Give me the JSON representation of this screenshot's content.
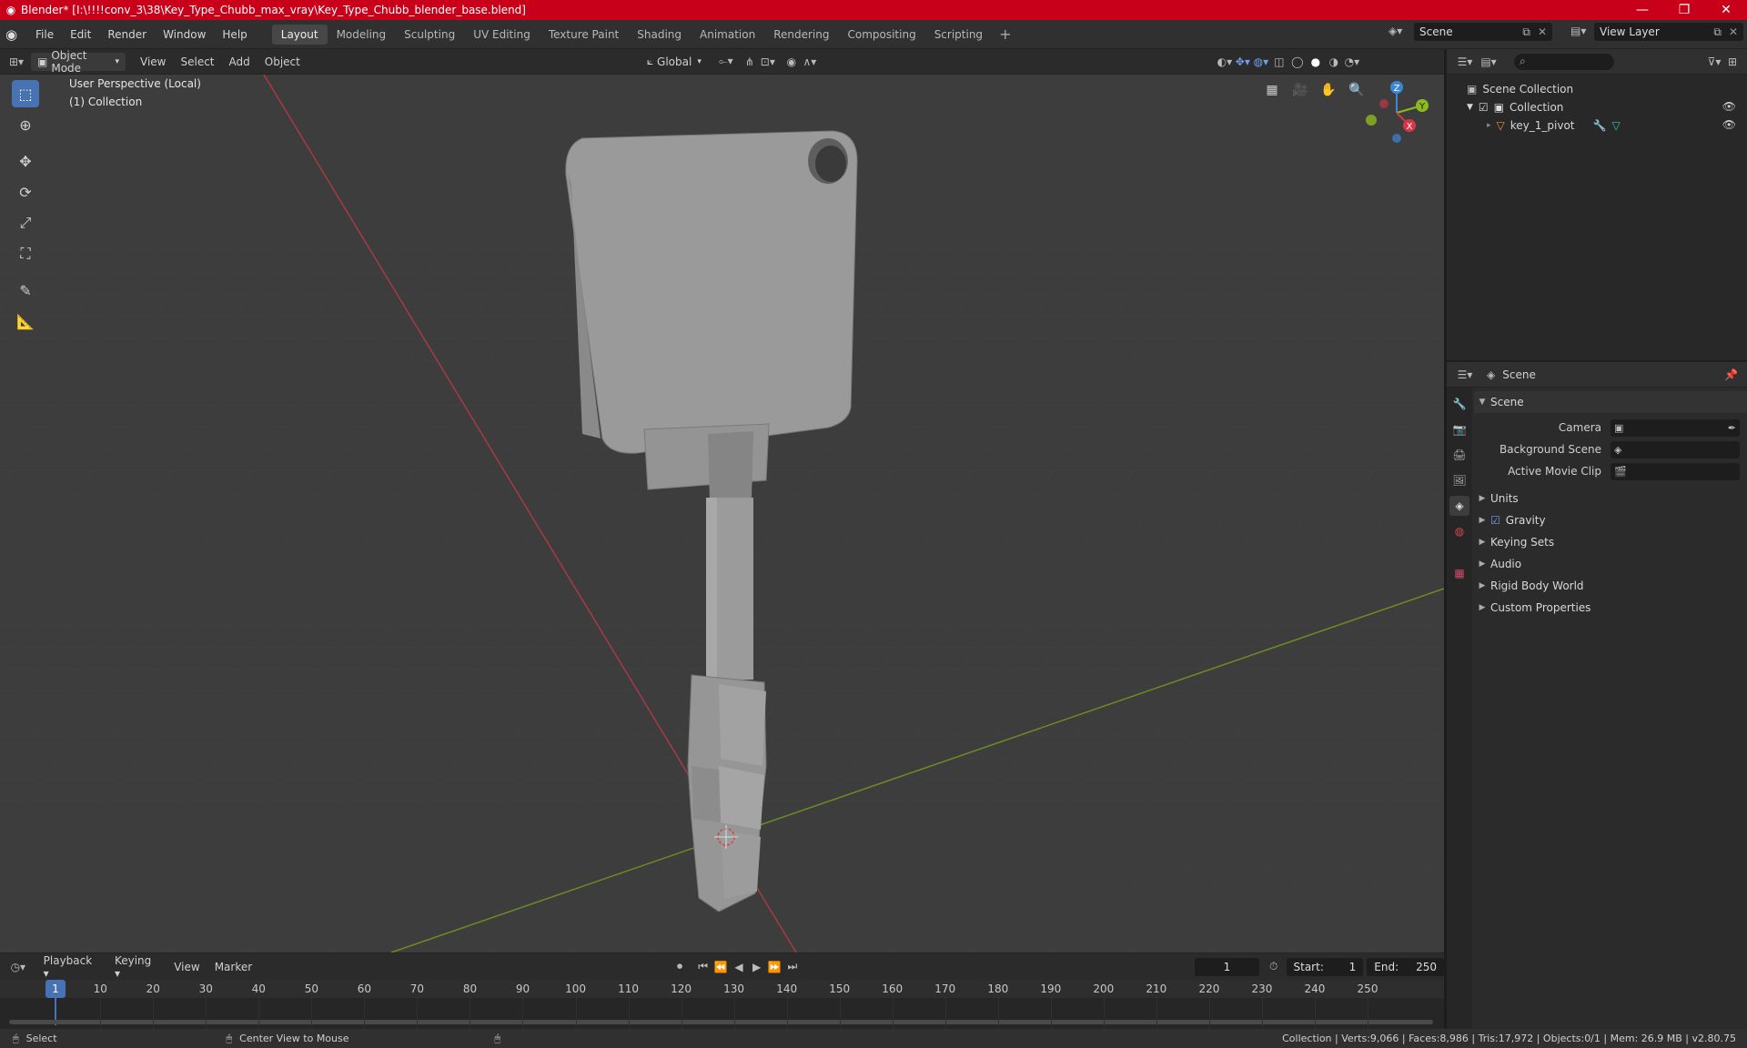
{
  "window": {
    "title": "Blender* [I:\\!!!!conv_3\\38\\Key_Type_Chubb_max_vray\\Key_Type_Chubb_blender_base.blend]",
    "minimize": "—",
    "maximize": "❐",
    "close": "✕"
  },
  "menu": {
    "file": "File",
    "edit": "Edit",
    "render": "Render",
    "window": "Window",
    "help": "Help"
  },
  "workspaces": [
    "Layout",
    "Modeling",
    "Sculpting",
    "UV Editing",
    "Texture Paint",
    "Shading",
    "Animation",
    "Rendering",
    "Compositing",
    "Scripting"
  ],
  "scene_name": "Scene",
  "view_layer": "View Layer",
  "viewport_header": {
    "mode": "Object Mode",
    "view": "View",
    "select": "Select",
    "add": "Add",
    "object": "Object",
    "orientation": "Global"
  },
  "viewport": {
    "perspective": "User Perspective (Local)",
    "collection": "(1) Collection"
  },
  "gizmo": {
    "z": "Z",
    "y": "Y",
    "x": "X"
  },
  "outliner": {
    "scene_collection": "Scene Collection",
    "collection": "Collection",
    "object": "key_1_pivot"
  },
  "properties": {
    "header": "Scene",
    "panel": "Scene",
    "camera_label": "Camera",
    "background_label": "Background Scene",
    "clip_label": "Active Movie Clip",
    "panels": [
      "Units",
      "Gravity",
      "Keying Sets",
      "Audio",
      "Rigid Body World",
      "Custom Properties"
    ]
  },
  "timeline": {
    "playback": "Playback",
    "keying": "Keying",
    "view": "View",
    "marker": "Marker",
    "current_frame": "1",
    "start_label": "Start:",
    "start": "1",
    "end_label": "End:",
    "end": "250",
    "ticks": [
      "1",
      "10",
      "20",
      "30",
      "40",
      "50",
      "60",
      "70",
      "80",
      "90",
      "100",
      "110",
      "120",
      "130",
      "140",
      "150",
      "160",
      "170",
      "180",
      "190",
      "200",
      "210",
      "220",
      "230",
      "240",
      "250"
    ]
  },
  "status": {
    "select": "Select",
    "center": "Center View to Mouse",
    "stats": "Collection | Verts:9,066 | Faces:8,986 | Tris:17,972 | Objects:0/1 | Mem: 26.9 MB | v2.80.75"
  },
  "colors": {
    "title_bar": "#c8001a",
    "accent": "#4772b3",
    "x_axis": "#d8344a",
    "y_axis": "#8dbb1d",
    "z_axis": "#3b86d6"
  }
}
